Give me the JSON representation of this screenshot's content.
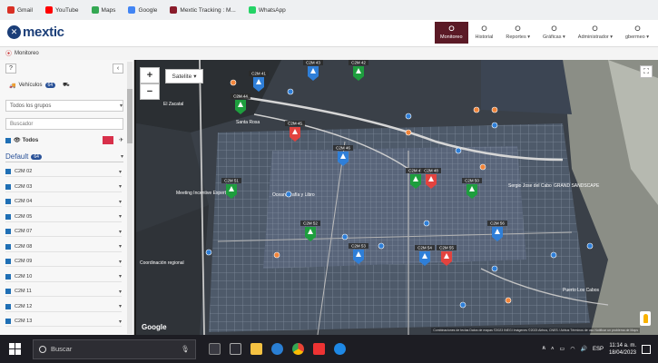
{
  "bookmarks": [
    {
      "label": "Gmail",
      "color": "#d93025"
    },
    {
      "label": "YouTube",
      "color": "#ff0000"
    },
    {
      "label": "Maps",
      "color": "#34a853"
    },
    {
      "label": "Google",
      "color": "#4285f4"
    },
    {
      "label": "Mextic Tracking : M...",
      "color": "#8a1c2b"
    },
    {
      "label": "WhatsApp",
      "color": "#25d366"
    }
  ],
  "app": {
    "logo_text": "mextic",
    "nav": [
      {
        "label": "Monitoreo",
        "icon": "map-pin-icon",
        "active": true
      },
      {
        "label": "Historial",
        "icon": "history-icon",
        "active": false
      },
      {
        "label": "Reportes ▾",
        "icon": "report-icon",
        "active": false
      },
      {
        "label": "Gráficas ▾",
        "icon": "chart-icon",
        "active": false
      },
      {
        "label": "Administrador ▾",
        "icon": "admin-icon",
        "active": false
      },
      {
        "label": "gbermeo ▾",
        "icon": "user-icon",
        "active": false
      }
    ],
    "breadcrumb": "Monitoreo"
  },
  "sidebar": {
    "help_label": "?",
    "collapse_label": "‹",
    "vehicles_tab": "Vehículos",
    "vehicles_count": "64",
    "groups_select": "Todos los grupos",
    "search_placeholder": "Buscador",
    "all_label": "Todos",
    "group_name": "Default",
    "group_count": "64",
    "units": [
      "C2M 02",
      "C2M 03",
      "C2M 04",
      "C2M 05",
      "C2M 07",
      "C2M 08",
      "C2M 09",
      "C2M 10",
      "C2M 11",
      "C2M 12",
      "C2M 13"
    ]
  },
  "map": {
    "type_label": "Satelite",
    "zoom_in": "+",
    "zoom_out": "−",
    "google": "Google",
    "attribution": "Combinaciones de teclas   Datos de mapas ©2023 INEGI   Imágenes ©2023 Airbus, CNES / Airbus   Términos de uso   Notificar un problema de Maps",
    "places": [
      "Meeting Incentive Experts",
      "Oceanografía y Libro",
      "Coordinación regional",
      "Santa Rosa",
      "Puerto Los Cabos",
      "GRAND SANDSCAPE",
      "El Zacatal",
      "Sergio Jose del Cabo"
    ],
    "pins": [
      "C2M 41",
      "C2M 42",
      "C2M 43",
      "C2M 44",
      "C2M 45",
      "C2M 46",
      "C2M 47",
      "C2M 48",
      "C2M 50",
      "C2M 51",
      "C2M 52",
      "C2M 53",
      "C2M 54",
      "C2M 55",
      "C2M 56"
    ],
    "pin_colors": {
      "green": "#1e9e3e",
      "red": "#e2433f",
      "blue": "#2f7fd8",
      "orange": "#f2853a"
    }
  },
  "taskbar": {
    "search": "Buscar",
    "time": "11:14 a. m.",
    "date": "18/04/2023",
    "lang": "ESP"
  }
}
